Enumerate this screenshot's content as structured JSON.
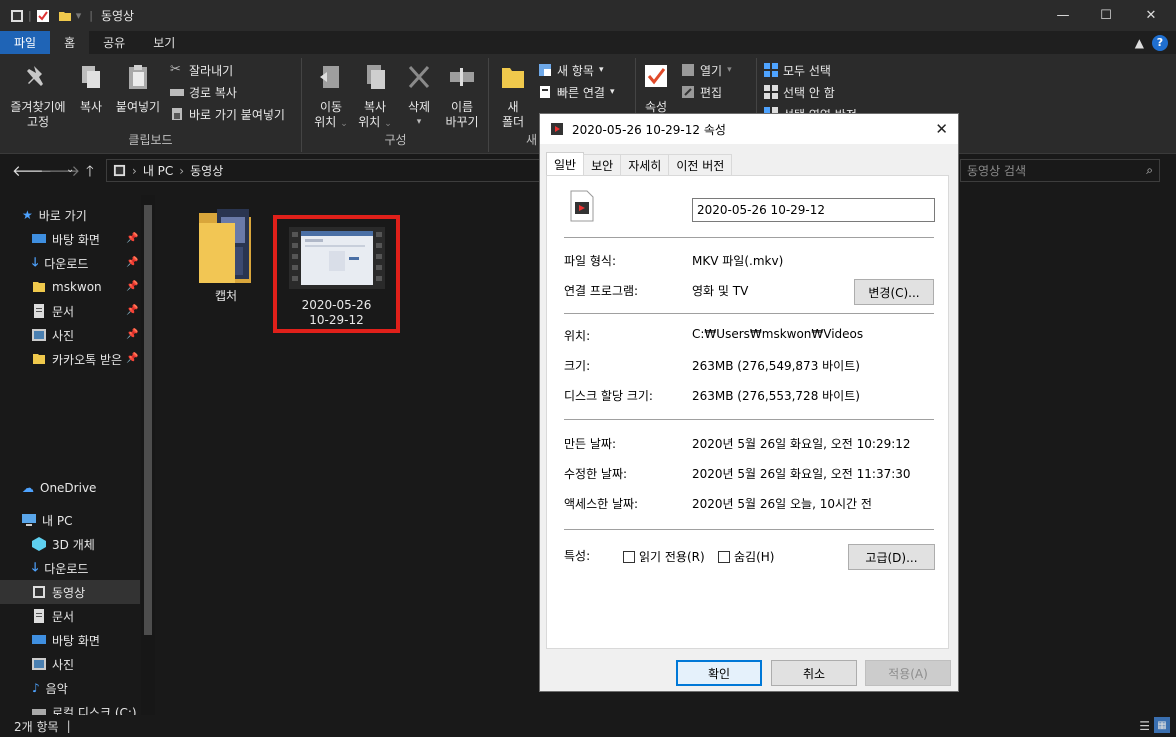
{
  "window": {
    "title": "동영상",
    "minimize": "—",
    "maximize": "☐",
    "close": "✕"
  },
  "ribbon_tabs": [
    "파일",
    "홈",
    "공유",
    "보기"
  ],
  "ribbon": {
    "clipboard": {
      "pin_label_1": "즐겨찾기에",
      "pin_label_2": "고정",
      "copy_label": "복사",
      "paste_label": "붙여넣기",
      "cut": "잘라내기",
      "copy_path": "경로 복사",
      "paste_shortcut": "바로 가기 붙여넣기",
      "group_label": "클립보드"
    },
    "organize": {
      "move_1": "이동",
      "move_2": "위치",
      "copyto_1": "복사",
      "copyto_2": "위치",
      "delete": "삭제",
      "rename_1": "이름",
      "rename_2": "바꾸기",
      "group_label": "구성"
    },
    "new": {
      "new_folder_1": "새",
      "new_folder_2": "폴더",
      "new_item": "새 항목",
      "easy_access": "빠른 연결",
      "group_label_partial": "새"
    },
    "open": {
      "properties": "속성",
      "open": "열기",
      "edit": "편집"
    },
    "select": {
      "select_all": "모두 선택",
      "select_none": "선택 안 함",
      "invert": "선택 영역 반전"
    }
  },
  "address": {
    "segments": [
      "내 PC",
      "동영상"
    ],
    "search_placeholder": "동영상 검색"
  },
  "nav": {
    "quick_access": "바로 가기",
    "quick_items": [
      "바탕 화면",
      "다운로드",
      "mskwon",
      "문서",
      "사진",
      "카카오톡 받은"
    ],
    "onedrive": "OneDrive",
    "this_pc": "내 PC",
    "pc_items": [
      "3D 개체",
      "다운로드",
      "동영상",
      "문서",
      "바탕 화면",
      "사진",
      "음악",
      "로컬 디스크 (C:)"
    ]
  },
  "files": [
    {
      "name": "캡처"
    },
    {
      "name_line1": "2020-05-26",
      "name_line2": "10-29-12"
    }
  ],
  "status": {
    "count": "2개 항목"
  },
  "dialog": {
    "title": "2020-05-26 10-29-12 속성",
    "tabs": [
      "일반",
      "보안",
      "자세히",
      "이전 버전"
    ],
    "filename": "2020-05-26 10-29-12",
    "file_type_label": "파일 형식:",
    "file_type": "MKV 파일(.mkv)",
    "opens_with_label": "연결 프로그램:",
    "opens_with": "영화 및 TV",
    "change_button": "변경(C)...",
    "location_label": "위치:",
    "location": "C:₩Users₩mskwon₩Videos",
    "size_label": "크기:",
    "size": "263MB (276,549,873 바이트)",
    "disk_size_label": "디스크 할당 크기:",
    "disk_size": "263MB (276,553,728 바이트)",
    "created_label": "만든 날짜:",
    "created": "2020년 5월 26일 화요일, 오전 10:29:12",
    "modified_label": "수정한 날짜:",
    "modified": "2020년 5월 26일 화요일, 오전 11:37:30",
    "accessed_label": "액세스한 날짜:",
    "accessed": "2020년 5월 26일 오늘, 10시간 전",
    "attributes_label": "특성:",
    "readonly": "읽기 전용(R)",
    "hidden": "숨김(H)",
    "advanced_button": "고급(D)...",
    "ok": "확인",
    "cancel": "취소",
    "apply": "적용(A)"
  },
  "colors": {
    "accent": "#1f64b6",
    "highlight": "#e0201a",
    "dark_bg": "#191919"
  }
}
